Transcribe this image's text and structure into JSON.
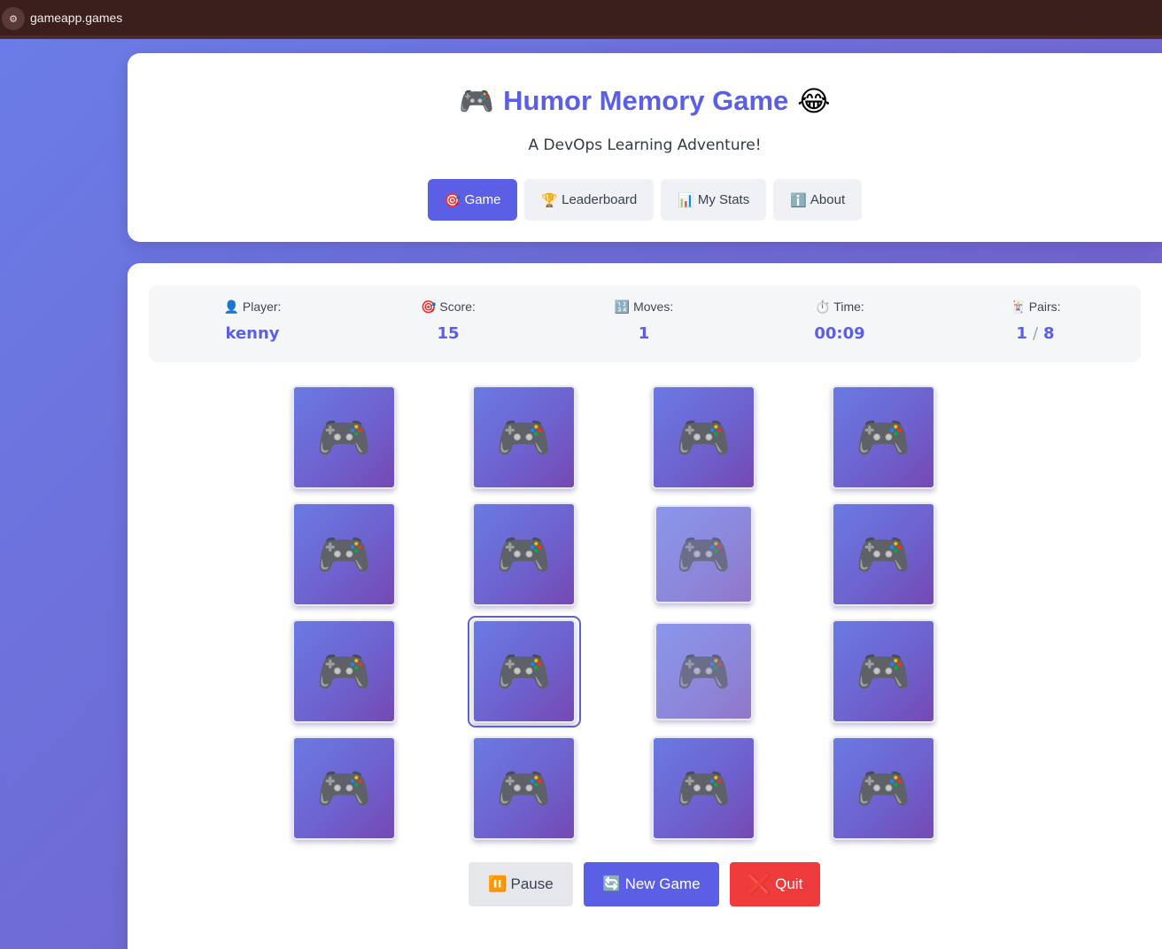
{
  "browser": {
    "url": "gameapp.games",
    "site_settings_icon": "tune-icon"
  },
  "header": {
    "title": "Humor Memory Game",
    "title_left_emoji": "🎮",
    "title_right_emoji": "😂",
    "subtitle": "A DevOps Learning Adventure!",
    "nav": [
      {
        "icon": "🎯",
        "label": "Game",
        "active": true
      },
      {
        "icon": "🏆",
        "label": "Leaderboard",
        "active": false
      },
      {
        "icon": "📊",
        "label": "My Stats",
        "active": false
      },
      {
        "icon": "ℹ️",
        "label": "About",
        "active": false
      }
    ]
  },
  "stats": {
    "player": {
      "icon": "👤",
      "label": "Player:",
      "value": "kenny"
    },
    "score": {
      "icon": "🎯",
      "label": "Score:",
      "value": "15"
    },
    "moves": {
      "icon": "🔢",
      "label": "Moves:",
      "value": "1"
    },
    "time": {
      "icon": "⏱️",
      "label": "Time:",
      "value": "00:09"
    },
    "pairs": {
      "icon": "🃏",
      "label": "Pairs:",
      "found": "1",
      "separator": "/",
      "total": "8"
    }
  },
  "board": {
    "card_face": "🎮",
    "rows": 4,
    "cols": 4,
    "matched_cards": [
      [
        1,
        2
      ],
      [
        2,
        2
      ]
    ],
    "focused_card": [
      2,
      1
    ]
  },
  "controls": {
    "pause": {
      "icon": "⏸️",
      "label": "Pause"
    },
    "new_game": {
      "icon": "🔄",
      "label": "New Game"
    },
    "quit": {
      "icon": "❌",
      "label": "Quit"
    }
  },
  "colors": {
    "accent": "#5b5fe6",
    "danger": "#ef3b3b",
    "card_gradient_start": "#6a7ae3",
    "card_gradient_end": "#7549b2"
  }
}
